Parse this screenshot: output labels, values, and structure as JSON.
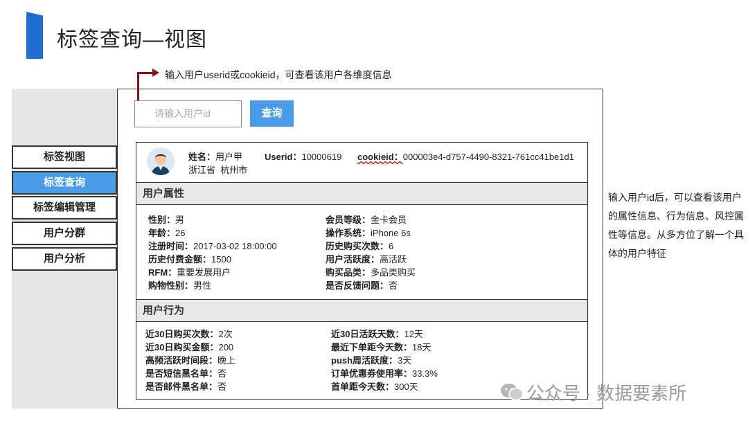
{
  "page": {
    "title": "标签查询—视图"
  },
  "annotations": {
    "top": "输入用户userid或cookieid，可查看该用户各维度信息",
    "right": "输入用户id后，可以查看该用户的属性信息、行为信息、风控属性等信息。从多方位了解一个具体的用户特征"
  },
  "nav": {
    "items": [
      {
        "label": "标签视图"
      },
      {
        "label": "标签查询"
      },
      {
        "label": "标签编辑管理"
      },
      {
        "label": "用户分群"
      },
      {
        "label": "用户分析"
      }
    ]
  },
  "search": {
    "placeholder": "请输入用户id",
    "button": "查询"
  },
  "user": {
    "name_label": "姓名：",
    "name": "用户甲",
    "userid_label": "Userid：",
    "userid": "10000619",
    "cookieid_label": "cookieid：",
    "cookieid": "000003e4-d757-4490-8321-761cc41be1d1",
    "province": "浙江省",
    "city": "杭州市"
  },
  "attributes": {
    "title": "用户属性",
    "left": [
      {
        "k": "性别：",
        "v": "男"
      },
      {
        "k": "年龄：",
        "v": "26"
      },
      {
        "k": "注册时间：",
        "v": "2017-03-02 18:00:00"
      },
      {
        "k": "历史付费金额：",
        "v": "1500"
      },
      {
        "k": "RFM：",
        "v": "重要发展用户"
      },
      {
        "k": "购物性别：",
        "v": "男性"
      }
    ],
    "right": [
      {
        "k": "会员等级：",
        "v": "金卡会员"
      },
      {
        "k": "操作系统：",
        "v": "iPhone 6s"
      },
      {
        "k": "历史购买次数：",
        "v": "6"
      },
      {
        "k": "用户活跃度：",
        "v": "高活跃"
      },
      {
        "k": "购买品类：",
        "v": "多品类购买"
      },
      {
        "k": "是否反馈问题：",
        "v": "否"
      }
    ]
  },
  "behavior": {
    "title": "用户行为",
    "left": [
      {
        "k": "近30日购买次数：",
        "v": "2次"
      },
      {
        "k": "近30日购买金额：",
        "v": "200"
      },
      {
        "k": "高频活跃时间段：",
        "v": "晚上"
      },
      {
        "k": "是否短信黑名单：",
        "v": "否"
      },
      {
        "k": "是否邮件黑名单：",
        "v": "否"
      }
    ],
    "right": [
      {
        "k": "近30日活跃天数：",
        "v": "12天"
      },
      {
        "k": "最近下单距今天数：",
        "v": "18天"
      },
      {
        "k": "push周活跃度：",
        "v": "3天"
      },
      {
        "k": "订单优惠券使用率：",
        "v": "33.3%"
      },
      {
        "k": "首单距今天数：",
        "v": "300天"
      }
    ]
  },
  "watermark": "公众号 · 数据要素所",
  "colors": {
    "accent": "#4a9be8",
    "title_bar": "#1f6fd1",
    "arrow": "#8b0d1a"
  }
}
